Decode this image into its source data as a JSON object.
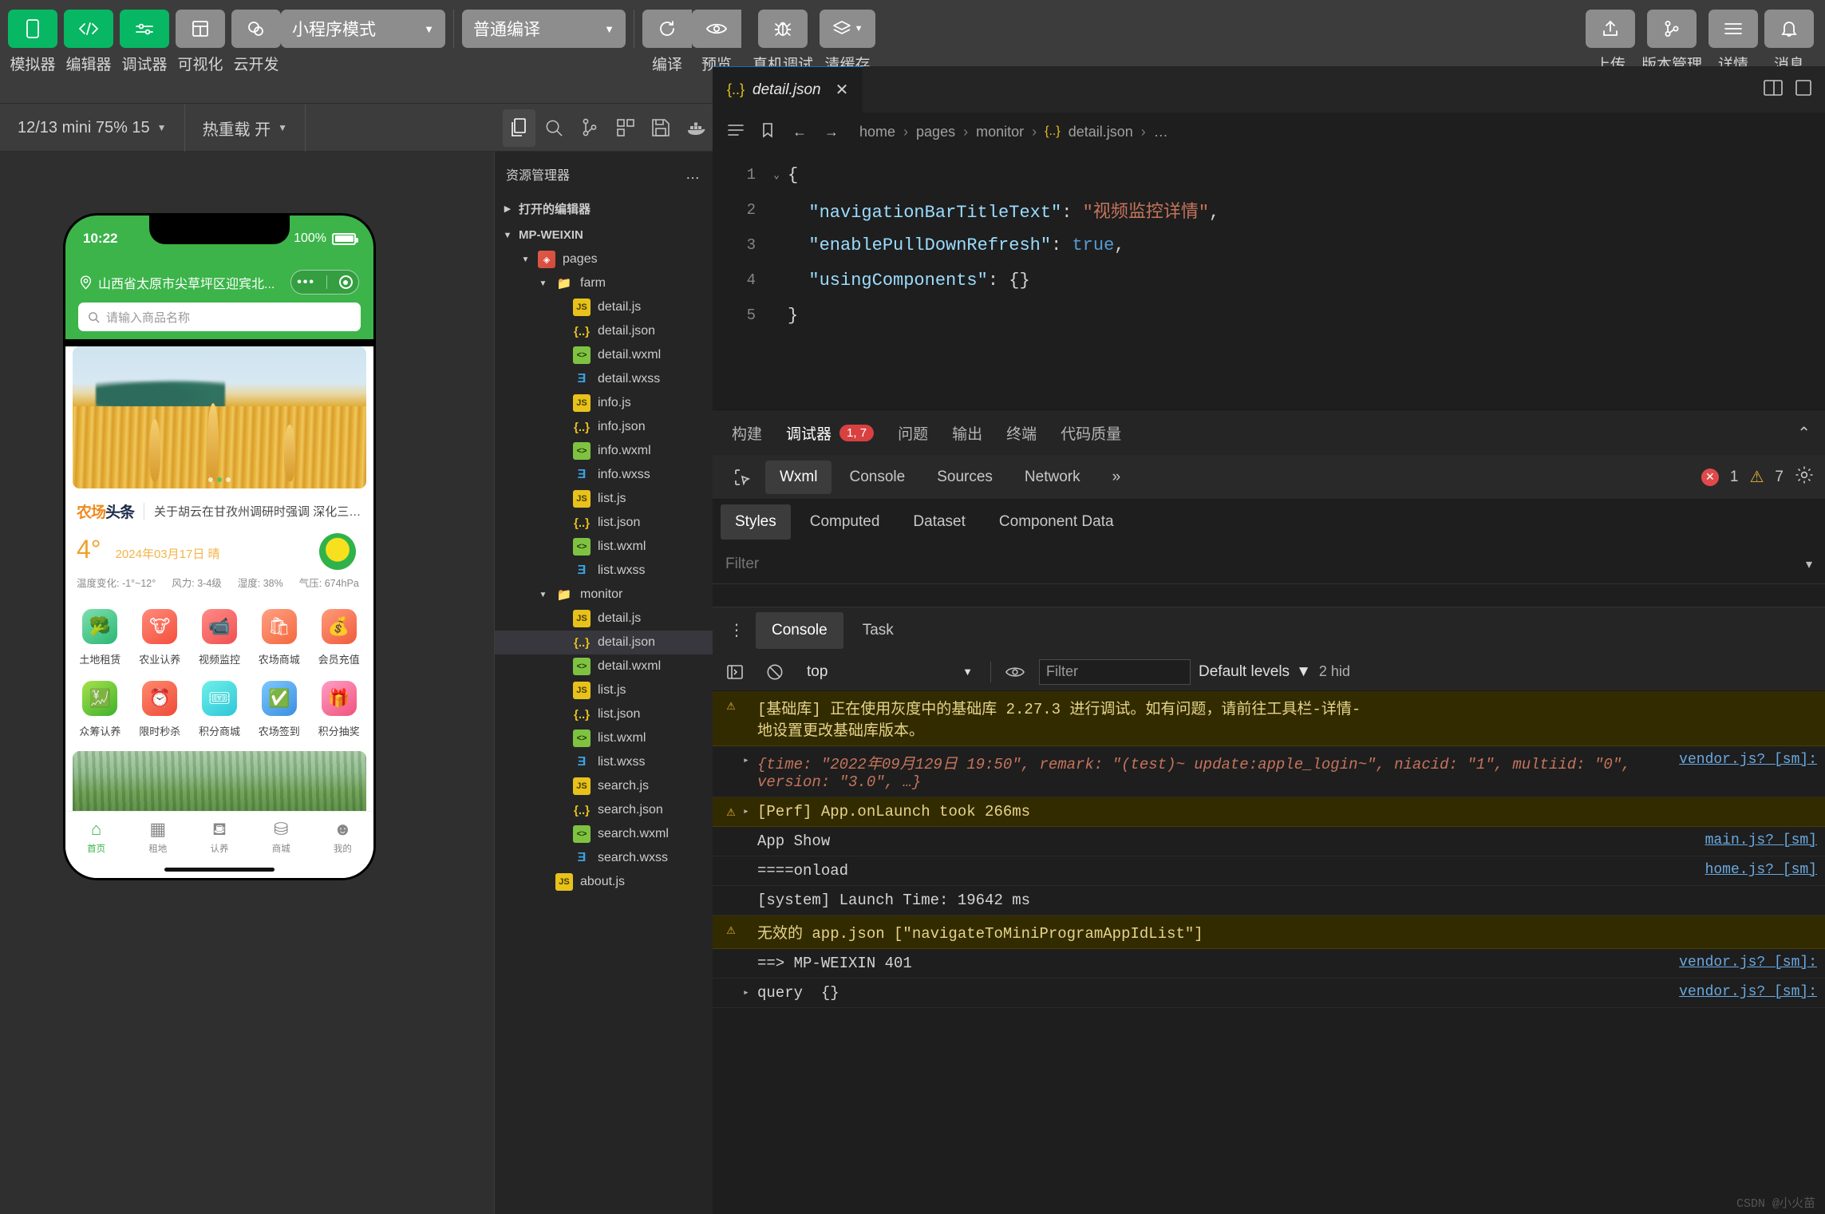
{
  "toolbar": {
    "left_buttons": [
      {
        "label": "模拟器",
        "icon": "phone-icon",
        "style": "green"
      },
      {
        "label": "编辑器",
        "icon": "code-icon",
        "style": "green"
      },
      {
        "label": "调试器",
        "icon": "sliders-icon",
        "style": "green"
      },
      {
        "label": "可视化",
        "icon": "layout-icon",
        "style": "grey"
      },
      {
        "label": "云开发",
        "icon": "cloud-icon",
        "style": "grey"
      }
    ],
    "mode_select": "小程序模式",
    "compile_select": "普通编译",
    "action_buttons": [
      {
        "label": "编译",
        "icon": "refresh-icon"
      },
      {
        "label": "预览",
        "icon": "eye-icon"
      },
      {
        "label": "真机调试",
        "icon": "bug-icon"
      },
      {
        "label": "清缓存",
        "icon": "layers-icon"
      }
    ],
    "right_buttons": [
      {
        "label": "上传",
        "icon": "upload-icon"
      },
      {
        "label": "版本管理",
        "icon": "branch-icon"
      },
      {
        "label": "详情",
        "icon": "hamburger-icon"
      },
      {
        "label": "消息",
        "icon": "bell-icon"
      }
    ]
  },
  "secondbar": {
    "device": "12/13 mini 75% 15",
    "hotreload": "热重载 开",
    "icons": [
      "refresh-icon",
      "stop-icon",
      "device-icon",
      "windows-icon"
    ]
  },
  "simulator": {
    "status": {
      "time": "10:22",
      "battery": "100%"
    },
    "location": "山西省太原市尖草坪区迎宾北...",
    "search_placeholder": "请输入商品名称",
    "news": {
      "logo_orange": "农场",
      "logo_dark": "头条",
      "headline": "关于胡云在甘孜州调研时强调 深化三产融合 助力..."
    },
    "weather": {
      "temp": "4°",
      "date": "2024年03月17日 晴",
      "details": [
        "温度变化: -1°~12°",
        "风力: 3-4级",
        "湿度: 38%",
        "气压: 674hPa"
      ]
    },
    "grid": [
      {
        "label": "土地租赁",
        "icon": "broccoli-icon",
        "glyph": "🥦"
      },
      {
        "label": "农业认养",
        "icon": "cow-icon",
        "glyph": "🐮"
      },
      {
        "label": "视频监控",
        "icon": "camera-icon",
        "glyph": "📹"
      },
      {
        "label": "农场商城",
        "icon": "bag-icon",
        "glyph": "🛍"
      },
      {
        "label": "会员充值",
        "icon": "wallet-icon",
        "glyph": "💰"
      },
      {
        "label": "众筹认养",
        "icon": "money-hand-icon",
        "glyph": "💹"
      },
      {
        "label": "限时秒杀",
        "icon": "alarm-icon",
        "glyph": "⏰"
      },
      {
        "label": "积分商城",
        "icon": "ticket-icon",
        "glyph": "🎟"
      },
      {
        "label": "农场签到",
        "icon": "check-icon",
        "glyph": "✅"
      },
      {
        "label": "积分抽奖",
        "icon": "gift-icon",
        "glyph": "🎁"
      }
    ],
    "tabbar": [
      {
        "label": "首页",
        "icon": "home-icon",
        "glyph": "⌂",
        "active": true
      },
      {
        "label": "租地",
        "icon": "land-icon",
        "glyph": "▦",
        "active": false
      },
      {
        "label": "认养",
        "icon": "adopt-icon",
        "glyph": "⛾",
        "active": false
      },
      {
        "label": "商城",
        "icon": "shop-icon",
        "glyph": "⛁",
        "active": false
      },
      {
        "label": "我的",
        "icon": "user-icon",
        "glyph": "☻",
        "active": false
      }
    ]
  },
  "explorer": {
    "title": "资源管理器",
    "more": "…",
    "sections": [
      {
        "label": "打开的编辑器",
        "expanded": false
      },
      {
        "label": "MP-WEIXIN",
        "expanded": true
      }
    ],
    "tree": [
      {
        "label": "pages",
        "type": "pages",
        "depth": 1,
        "expanded": true,
        "selected": false
      },
      {
        "label": "farm",
        "type": "folder",
        "depth": 2,
        "expanded": true,
        "selected": false
      },
      {
        "label": "detail.js",
        "type": "js",
        "depth": 3,
        "selected": false
      },
      {
        "label": "detail.json",
        "type": "json",
        "depth": 3,
        "selected": false
      },
      {
        "label": "detail.wxml",
        "type": "wxml",
        "depth": 3,
        "selected": false
      },
      {
        "label": "detail.wxss",
        "type": "wxss",
        "depth": 3,
        "selected": false
      },
      {
        "label": "info.js",
        "type": "js",
        "depth": 3,
        "selected": false
      },
      {
        "label": "info.json",
        "type": "json",
        "depth": 3,
        "selected": false
      },
      {
        "label": "info.wxml",
        "type": "wxml",
        "depth": 3,
        "selected": false
      },
      {
        "label": "info.wxss",
        "type": "wxss",
        "depth": 3,
        "selected": false
      },
      {
        "label": "list.js",
        "type": "js",
        "depth": 3,
        "selected": false
      },
      {
        "label": "list.json",
        "type": "json",
        "depth": 3,
        "selected": false
      },
      {
        "label": "list.wxml",
        "type": "wxml",
        "depth": 3,
        "selected": false
      },
      {
        "label": "list.wxss",
        "type": "wxss",
        "depth": 3,
        "selected": false
      },
      {
        "label": "monitor",
        "type": "folder",
        "depth": 2,
        "expanded": true,
        "selected": false
      },
      {
        "label": "detail.js",
        "type": "js",
        "depth": 3,
        "selected": false
      },
      {
        "label": "detail.json",
        "type": "json",
        "depth": 3,
        "selected": true
      },
      {
        "label": "detail.wxml",
        "type": "wxml",
        "depth": 3,
        "selected": false
      },
      {
        "label": "list.js",
        "type": "js",
        "depth": 3,
        "selected": false
      },
      {
        "label": "list.json",
        "type": "json",
        "depth": 3,
        "selected": false
      },
      {
        "label": "list.wxml",
        "type": "wxml",
        "depth": 3,
        "selected": false
      },
      {
        "label": "list.wxss",
        "type": "wxss",
        "depth": 3,
        "selected": false
      },
      {
        "label": "search.js",
        "type": "js",
        "depth": 3,
        "selected": false
      },
      {
        "label": "search.json",
        "type": "json",
        "depth": 3,
        "selected": false
      },
      {
        "label": "search.wxml",
        "type": "wxml",
        "depth": 3,
        "selected": false
      },
      {
        "label": "search.wxss",
        "type": "wxss",
        "depth": 3,
        "selected": false
      },
      {
        "label": "about.js",
        "type": "js",
        "depth": 2,
        "selected": false
      }
    ]
  },
  "editor": {
    "tab": {
      "name": "detail.json",
      "icon": "json-icon",
      "close": "✕"
    },
    "breadcrumb": [
      "home",
      "pages",
      "monitor",
      "detail.json",
      "…"
    ],
    "nav_back": "←",
    "nav_fwd": "→",
    "lines": [
      {
        "num": "1",
        "fold": "⌄",
        "tokens": [
          {
            "t": "{",
            "c": "punc"
          }
        ]
      },
      {
        "num": "2",
        "fold": "",
        "tokens": [
          {
            "t": "  \"navigationBarTitleText\"",
            "c": "key"
          },
          {
            "t": ": ",
            "c": "punc"
          },
          {
            "t": "\"视频监控详情\"",
            "c": "strcn"
          },
          {
            "t": ",",
            "c": "punc"
          }
        ]
      },
      {
        "num": "3",
        "fold": "",
        "tokens": [
          {
            "t": "  \"enablePullDownRefresh\"",
            "c": "key"
          },
          {
            "t": ": ",
            "c": "punc"
          },
          {
            "t": "true",
            "c": "bool"
          },
          {
            "t": ",",
            "c": "punc"
          }
        ]
      },
      {
        "num": "4",
        "fold": "",
        "tokens": [
          {
            "t": "  \"usingComponents\"",
            "c": "key"
          },
          {
            "t": ": ",
            "c": "punc"
          },
          {
            "t": "{}",
            "c": "punc"
          }
        ]
      },
      {
        "num": "5",
        "fold": "",
        "tokens": [
          {
            "t": "}",
            "c": "punc"
          }
        ]
      }
    ]
  },
  "debugger": {
    "tabs": [
      {
        "label": "构建",
        "selected": false,
        "badge": null
      },
      {
        "label": "调试器",
        "selected": true,
        "badge": "1, 7"
      },
      {
        "label": "问题",
        "selected": false,
        "badge": null
      },
      {
        "label": "输出",
        "selected": false,
        "badge": null
      },
      {
        "label": "终端",
        "selected": false,
        "badge": null
      },
      {
        "label": "代码质量",
        "selected": false,
        "badge": null
      }
    ],
    "devtools_tabs": [
      {
        "label": "Wxml",
        "selected": true
      },
      {
        "label": "Console",
        "selected": false
      },
      {
        "label": "Sources",
        "selected": false
      },
      {
        "label": "Network",
        "selected": false
      }
    ],
    "more": "»",
    "error_count": "1",
    "warn_count": "7",
    "styles_tabs": [
      {
        "label": "Styles",
        "selected": true
      },
      {
        "label": "Computed",
        "selected": false
      },
      {
        "label": "Dataset",
        "selected": false
      },
      {
        "label": "Component Data",
        "selected": false
      }
    ],
    "style_filter_placeholder": "Filter",
    "console_tabs": [
      {
        "label": "Console",
        "selected": true
      },
      {
        "label": "Task",
        "selected": false
      }
    ],
    "console_context": "top",
    "console_filter_placeholder": "Filter",
    "console_levels": "Default levels",
    "console_hidden": "2 hid",
    "log": [
      {
        "level": "warn",
        "icon": "warning-icon",
        "text": "[基础库] 正在使用灰度中的基础库 2.27.3 进行调试。如有问题，请前往工具栏-详情-\n地设置更改基础库版本。",
        "source": ""
      },
      {
        "level": "info",
        "icon": "",
        "expand": "▸",
        "text": "{time: \"2022年09月129日 19:50\", remark: \"(test)~ update:apple_login~\", niacid: \"1\", multiid: \"0\", version: \"3.0\", …}",
        "source": "vendor.js? [sm]:"
      },
      {
        "level": "warn",
        "icon": "warning-icon",
        "expand": "▸",
        "text": "[Perf] App.onLaunch took 266ms",
        "source": ""
      },
      {
        "level": "info",
        "icon": "",
        "text": "App Show",
        "source": "main.js? [sm]"
      },
      {
        "level": "info",
        "icon": "",
        "text": "====onload",
        "source": "home.js? [sm]"
      },
      {
        "level": "info",
        "icon": "",
        "text": "[system] Launch Time: 19642 ms",
        "source": ""
      },
      {
        "level": "warn",
        "icon": "warning-icon",
        "text": "无效的 app.json [\"navigateToMiniProgramAppIdList\"]",
        "source": ""
      },
      {
        "level": "info",
        "icon": "",
        "text": "==> MP-WEIXIN 401",
        "source": "vendor.js? [sm]:"
      },
      {
        "level": "info",
        "icon": "",
        "expand": "▸",
        "text": "query  {}",
        "source": "vendor.js? [sm]:"
      }
    ]
  },
  "colors": {
    "accent_green": "#07b763",
    "wechat_green": "#3cb44a",
    "warn_bg": "#332b00",
    "editor_bg": "#1e1e1e",
    "sidebar_bg": "#252526"
  }
}
